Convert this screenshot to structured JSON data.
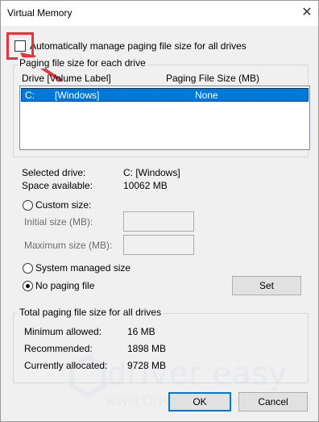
{
  "window": {
    "title": "Virtual Memory",
    "close_label": "✕"
  },
  "auto_manage": {
    "label": "Automatically manage paging file size for all drives",
    "checked": false
  },
  "drives_group": {
    "title": "Paging file size for each drive",
    "col_drive": "Drive  [Volume Label]",
    "col_size": "Paging File Size (MB)",
    "rows": [
      {
        "drive": "C:",
        "label": "[Windows]",
        "size": "None",
        "selected": true
      }
    ]
  },
  "selected": {
    "drive_label": "Selected drive:",
    "drive_value": "C:  [Windows]",
    "space_label": "Space available:",
    "space_value": "10062 MB"
  },
  "options": {
    "custom_label": "Custom size:",
    "initial_label": "Initial size (MB):",
    "initial_value": "",
    "max_label": "Maximum size (MB):",
    "max_value": "",
    "system_label": "System managed size",
    "none_label": "No paging file",
    "selected_option": "none",
    "set_label": "Set"
  },
  "totals": {
    "title": "Total paging file size for all drives",
    "min_label": "Minimum allowed:",
    "min_value": "16 MB",
    "rec_label": "Recommended:",
    "rec_value": "1898 MB",
    "cur_label": "Currently allocated:",
    "cur_value": "9728 MB"
  },
  "buttons": {
    "ok": "OK",
    "cancel": "Cancel"
  },
  "watermark": {
    "brand": "driver easy",
    "url": "www.DriverEasy.com"
  },
  "colors": {
    "accent": "#0078d7",
    "annotation": "#e8333f"
  }
}
